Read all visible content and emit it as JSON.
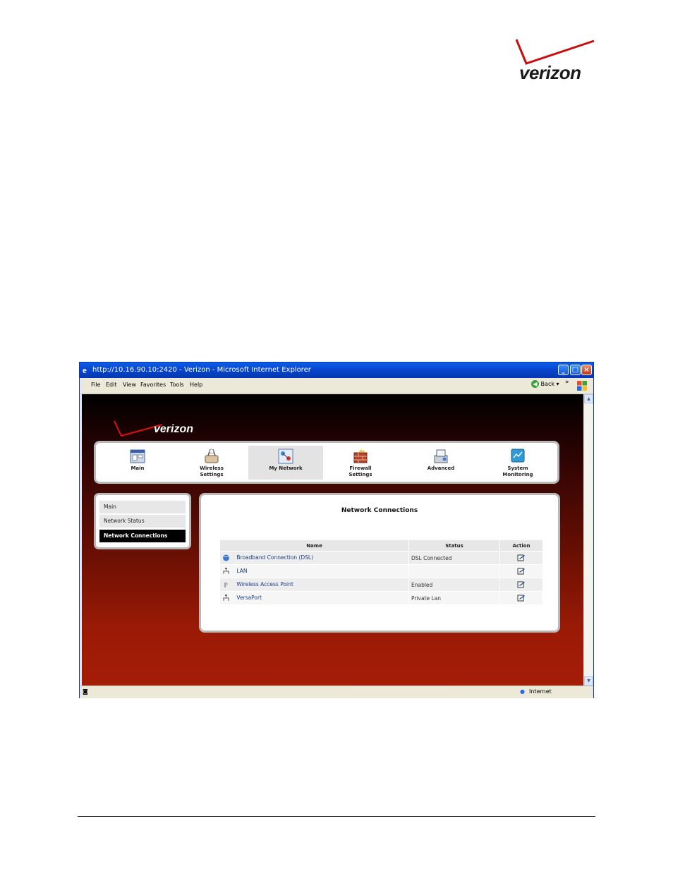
{
  "colors": {
    "brand_red": "#cd0b0b",
    "xp_blue": "#0846d0",
    "status_green": "#2e8b2e",
    "link_blue": "#1c3f86"
  },
  "page_logo": {
    "text": "verizon"
  },
  "browser": {
    "title": "http://10.16.90.10:2420 - Verizon - Microsoft Internet Explorer",
    "menu": [
      "File",
      "Edit",
      "View",
      "Favorites",
      "Tools",
      "Help"
    ],
    "back_label": "Back",
    "chevrons": "»",
    "status_zone": "Internet",
    "window_buttons": {
      "minimize": "_",
      "maximize": "□",
      "close": "×"
    }
  },
  "site": {
    "logo_text": "verizon",
    "nav": [
      {
        "label": "Main",
        "icon": "main-icon"
      },
      {
        "label": "Wireless\nSettings",
        "icon": "wireless-icon"
      },
      {
        "label": "My Network",
        "icon": "my-network-icon"
      },
      {
        "label": "Firewall\nSettings",
        "icon": "firewall-icon"
      },
      {
        "label": "Advanced",
        "icon": "advanced-icon"
      },
      {
        "label": "System\nMonitoring",
        "icon": "system-monitoring-icon"
      }
    ],
    "sidebar": [
      "Main",
      "Network Status",
      "Network Connections"
    ],
    "panel_title": "Network Connections",
    "table": {
      "headers": [
        "Name",
        "Status",
        "Action"
      ],
      "rows": [
        {
          "name": "Broadband Connection (DSL)",
          "status": "DSL Connected",
          "icon": "globe-icon"
        },
        {
          "name": "LAN",
          "status": "",
          "icon": "network-icon"
        },
        {
          "name": "Wireless Access Point",
          "status": "Enabled",
          "icon": "antenna-icon"
        },
        {
          "name": "VersaPort",
          "status": "Private Lan",
          "icon": "network-icon"
        }
      ]
    }
  }
}
